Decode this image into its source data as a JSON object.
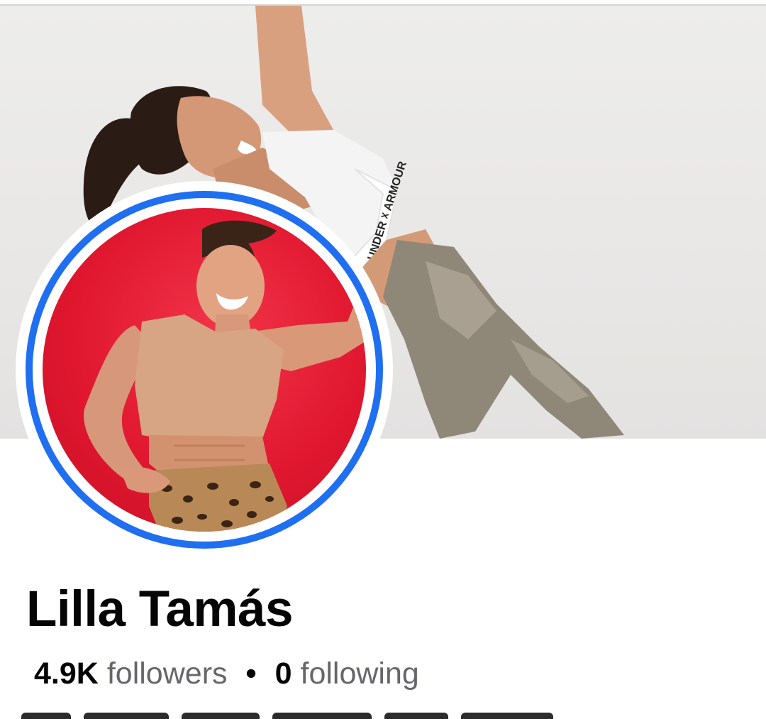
{
  "profile": {
    "name": "Lilla Tamás",
    "followers_count": "4.9K",
    "followers_label": "followers",
    "separator": "•",
    "following_count": "0",
    "following_label": "following"
  },
  "cover_photo": {
    "brand_text": "UNDER ☓ ARMOUR",
    "background_color": "#e9e8e7"
  },
  "profile_photo": {
    "border_color": "#1f6ff0",
    "background_color": "#e0172f"
  }
}
